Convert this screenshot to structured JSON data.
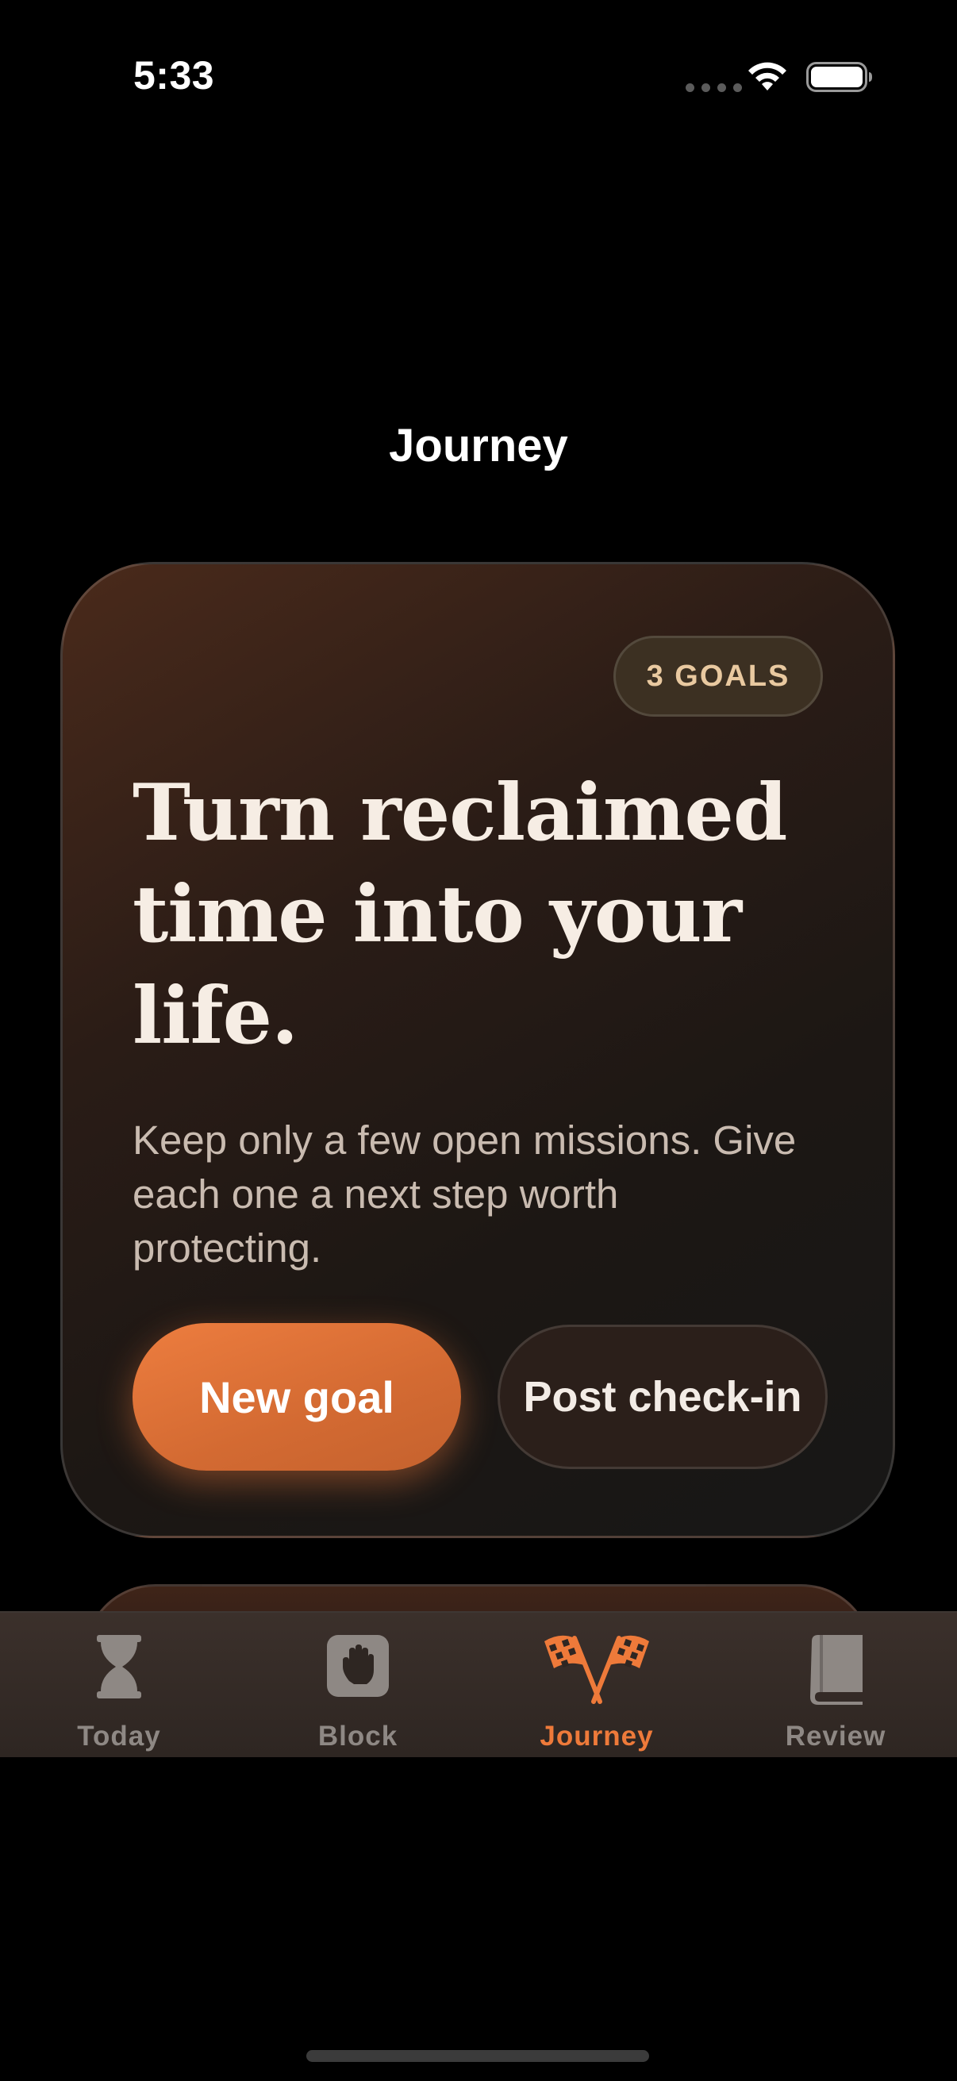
{
  "status_bar": {
    "time": "5:33"
  },
  "header": {
    "title": "Journey"
  },
  "hero_card": {
    "badge": "3 GOALS",
    "heading": "Turn reclaimed time into your life.",
    "body": "Keep only a few open missions. Give each one a next step worth protecting.",
    "primary_button": "New goal",
    "secondary_button": "Post check-in"
  },
  "tab_bar": {
    "active_color": "#ee7a3a",
    "inactive_color": "#8e8884",
    "tabs": [
      {
        "label": "Today",
        "icon": "hourglass-icon"
      },
      {
        "label": "Block",
        "icon": "hand-icon"
      },
      {
        "label": "Journey",
        "icon": "checkered-flags-icon",
        "active": true
      },
      {
        "label": "Review",
        "icon": "book-icon"
      }
    ]
  }
}
